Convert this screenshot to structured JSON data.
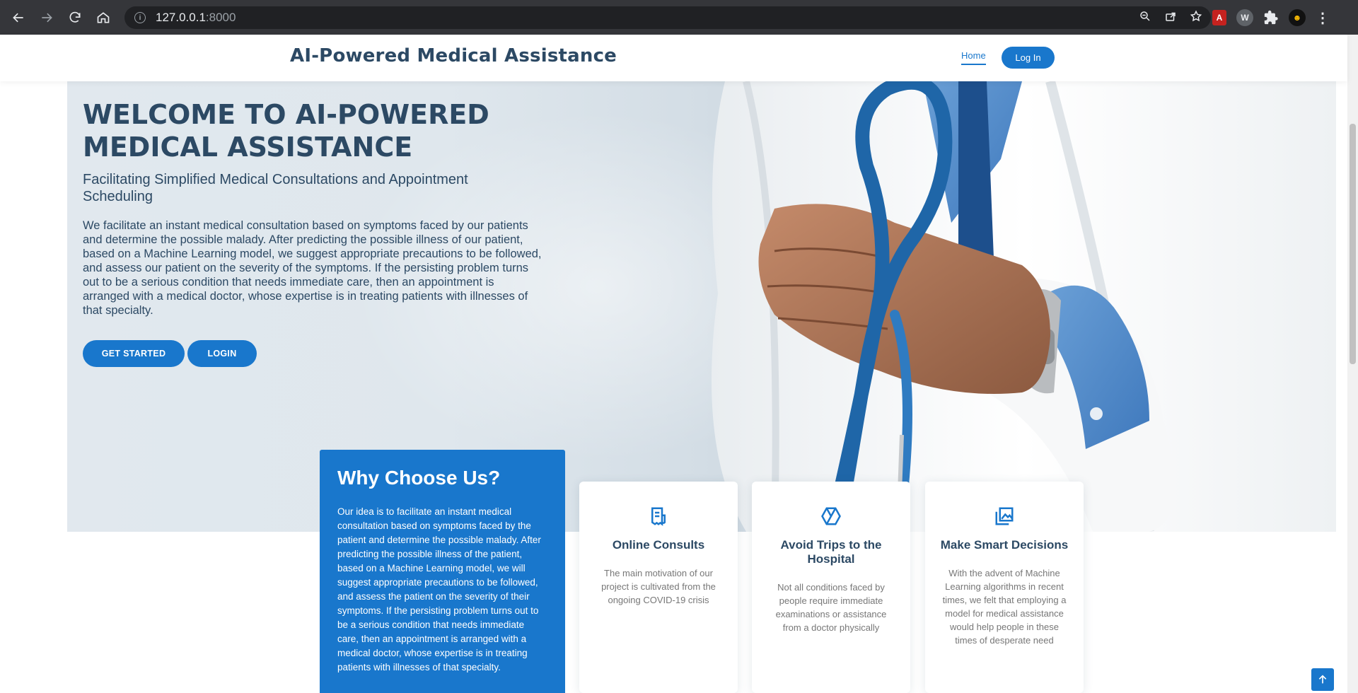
{
  "browser": {
    "url_host": "127.0.0.1",
    "url_port": ":8000",
    "icons": [
      "back-icon",
      "forward-icon",
      "reload-icon",
      "home-icon",
      "info-icon",
      "zoom-icon",
      "share-icon",
      "star-icon",
      "pdf-extension-icon",
      "w-extension-icon",
      "puzzle-icon",
      "profile-avatar",
      "kebab-menu-icon"
    ]
  },
  "header": {
    "brand": "AI-Powered Medical Assistance",
    "nav_home": "Home",
    "nav_login": "Log In"
  },
  "hero": {
    "title": "WELCOME TO AI-POWERED MEDICAL ASSISTANCE",
    "subtitle": "Facilitating Simplified Medical Consultations and Appointment Scheduling",
    "description": "We facilitate an instant medical consultation based on symptoms faced by our patients and determine the possible malady. After predicting the possible illness of our patient, based on a Machine Learning model, we suggest appropriate precautions to be followed, and assess our patient on the severity of the symptoms. If the persisting problem turns out to be a serious condition that needs immediate care, then an appointment is arranged with a medical doctor, whose expertise is in treating patients with illnesses of that specialty.",
    "btn_get_started": "GET STARTED",
    "btn_login": "LOGIN"
  },
  "why": {
    "title": "Why Choose Us?",
    "text": "Our idea is to facilitate an instant medical consultation based on symptoms faced by the patient and determine the possible malady. After predicting the possible illness of the patient, based on a Machine Learning model, we will suggest appropriate precautions to be followed, and assess the patient on the severity of their symptoms. If the persisting problem turns out to be a serious condition that needs immediate care, then an appointment is arranged with a medical doctor, whose expertise is in treating patients with illnesses of that specialty."
  },
  "cards": [
    {
      "title": "Online Consults",
      "text": "The main motivation of our project is cultivated from the ongoing COVID-19 crisis",
      "icon": "receipt-icon"
    },
    {
      "title": "Avoid Trips to the Hospital",
      "text": "Not all conditions faced by people require immediate examinations or assistance from a doctor physically",
      "icon": "cube-icon"
    },
    {
      "title": "Make Smart Decisions",
      "text": "With the advent of Machine Learning algorithms in recent times, we felt that employing a model for medical assistance would help people in these times of desperate need",
      "icon": "images-icon"
    }
  ],
  "colors": {
    "accent": "#1977cc",
    "heading": "#2c4964",
    "chrome": "#35363a"
  }
}
